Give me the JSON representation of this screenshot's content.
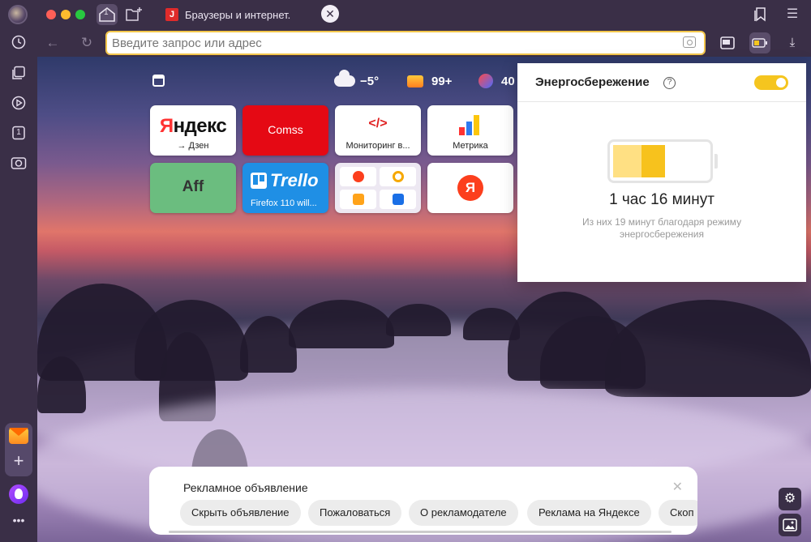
{
  "tab": {
    "title": "Браузеры и интернет. С",
    "favicon_letter": "J",
    "count": "1"
  },
  "address": {
    "placeholder": "Введите запрос или адрес"
  },
  "sidebar": {
    "tabs_count": "1"
  },
  "info": {
    "temperature": "−5°",
    "mail_count": "99+",
    "score": "40"
  },
  "tiles": [
    {
      "word_red": "Я",
      "word_rest": "ндекс",
      "caption": "→ Дзен"
    },
    {
      "label": "Comss",
      "color": "#e50914"
    },
    {
      "glyph": "</>",
      "caption": "Мониторинг в..."
    },
    {
      "caption": "Метрика"
    },
    {
      "label": "Aff",
      "color": "#6bbd7f"
    },
    {
      "label": "Trello",
      "caption": "Firefox 110 will...",
      "color": "#1f8fe5"
    },
    {
      "kind": "group"
    },
    {
      "letter": "Я",
      "color": "#fc3f1d"
    }
  ],
  "energy": {
    "title": "Энергосбережение",
    "help": "?",
    "time": "1 час 16 минут",
    "note": "Из них 19 минут благодаря режиму энергосбережения",
    "saving_fraction": 0.25,
    "charge_fraction": 0.55,
    "enabled": true
  },
  "ad": {
    "title": "Рекламное объявление",
    "chips": [
      "Скрыть объявление",
      "Пожаловаться",
      "О рекламодателе",
      "Реклама на Яндексе",
      "Скоп"
    ]
  },
  "colors": {
    "accent": "#f5c51f",
    "chrome": "#3a2f47"
  }
}
